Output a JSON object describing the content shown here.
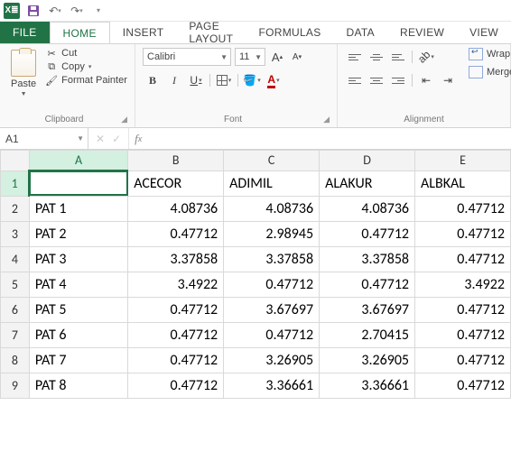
{
  "qat": {
    "save_tip": "Save",
    "undo_tip": "Undo",
    "redo_tip": "Redo"
  },
  "tabs": {
    "file": "FILE",
    "items": [
      "HOME",
      "INSERT",
      "PAGE LAYOUT",
      "FORMULAS",
      "DATA",
      "REVIEW",
      "VIEW"
    ],
    "active": 0
  },
  "ribbon": {
    "clipboard": {
      "label": "Clipboard",
      "paste": "Paste",
      "cut": "Cut",
      "copy": "Copy",
      "format_painter": "Format Painter"
    },
    "font": {
      "label": "Font",
      "name": "Calibri",
      "size": "11",
      "increase": "A",
      "decrease": "A",
      "bold": "B",
      "italic": "I",
      "underline": "U"
    },
    "alignment": {
      "label": "Alignment",
      "wrap": "Wrap Te",
      "merge": "Merge &"
    }
  },
  "namebox": "A1",
  "formula": "",
  "grid": {
    "columns": [
      "A",
      "B",
      "C",
      "D",
      "E"
    ],
    "active_col": 0,
    "active_row": 0,
    "headers_row": {
      "A": "",
      "B": "ACECOR",
      "C": "ADIMIL",
      "D": "ALAKUR",
      "E": "ALBKAL"
    },
    "rows": [
      {
        "n": 1,
        "label": "",
        "vals": [
          "ACECOR",
          "ADIMIL",
          "ALAKUR",
          "ALBKAL"
        ],
        "is_header": true
      },
      {
        "n": 2,
        "label": "PAT 1",
        "vals": [
          "4.08736",
          "4.08736",
          "4.08736",
          "0.47712"
        ]
      },
      {
        "n": 3,
        "label": "PAT 2",
        "vals": [
          "0.47712",
          "2.98945",
          "0.47712",
          "0.47712"
        ]
      },
      {
        "n": 4,
        "label": "PAT 3",
        "vals": [
          "3.37858",
          "3.37858",
          "3.37858",
          "0.47712"
        ]
      },
      {
        "n": 5,
        "label": "PAT 4",
        "vals": [
          "3.4922",
          "0.47712",
          "0.47712",
          "3.4922"
        ]
      },
      {
        "n": 6,
        "label": "PAT 5",
        "vals": [
          "0.47712",
          "3.67697",
          "3.67697",
          "0.47712"
        ]
      },
      {
        "n": 7,
        "label": "PAT 6",
        "vals": [
          "0.47712",
          "0.47712",
          "2.70415",
          "0.47712"
        ]
      },
      {
        "n": 8,
        "label": "PAT 7",
        "vals": [
          "0.47712",
          "3.26905",
          "3.26905",
          "0.47712"
        ]
      },
      {
        "n": 9,
        "label": "PAT 8",
        "vals": [
          "0.47712",
          "3.36661",
          "3.36661",
          "0.47712"
        ]
      }
    ]
  },
  "chart_data": {
    "type": "table",
    "columns": [
      "",
      "ACECOR",
      "ADIMIL",
      "ALAKUR",
      "ALBKAL"
    ],
    "rows": [
      [
        "PAT 1",
        4.08736,
        4.08736,
        4.08736,
        0.47712
      ],
      [
        "PAT 2",
        0.47712,
        2.98945,
        0.47712,
        0.47712
      ],
      [
        "PAT 3",
        3.37858,
        3.37858,
        3.37858,
        0.47712
      ],
      [
        "PAT 4",
        3.4922,
        0.47712,
        0.47712,
        3.4922
      ],
      [
        "PAT 5",
        0.47712,
        3.67697,
        3.67697,
        0.47712
      ],
      [
        "PAT 6",
        0.47712,
        0.47712,
        2.70415,
        0.47712
      ],
      [
        "PAT 7",
        0.47712,
        3.26905,
        3.26905,
        0.47712
      ],
      [
        "PAT 8",
        0.47712,
        3.36661,
        3.36661,
        0.47712
      ]
    ]
  }
}
